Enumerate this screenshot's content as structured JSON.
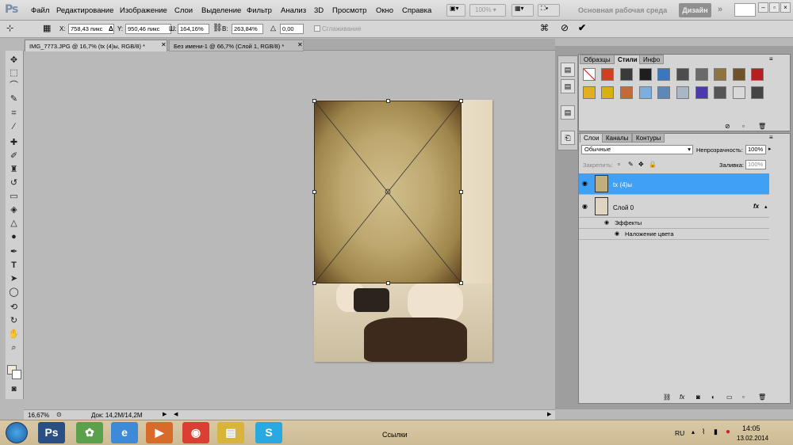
{
  "app": {
    "logo": "Ps"
  },
  "menu": [
    "Файл",
    "Редактирование",
    "Изображение",
    "Слои",
    "Выделение",
    "Фильтр",
    "Анализ",
    "3D",
    "Просмотр",
    "Окно",
    "Справка"
  ],
  "menubar_extras": {
    "zoom": "100%",
    "workspace": "Основная рабочая среда",
    "design": "Дизайн",
    "chevron": "»"
  },
  "options": {
    "x_label": "X:",
    "x_value": "758,43 пикс",
    "delta_label": "Δ",
    "y_label": "Y:",
    "y_value": "950,46 пикс",
    "w_label": "Ш:",
    "w_value": "164,16%",
    "h_label": "В:",
    "h_value": "263,84%",
    "angle_value": "0,00",
    "smoothing_label": "Сглаживание"
  },
  "tabs": [
    {
      "label": "IMG_7773.JPG @ 16,7% (tx (4)ы, RGB/8) *",
      "active": true
    },
    {
      "label": "Без имени-1 @ 66,7% (Слой 1, RGB/8) *",
      "active": false
    }
  ],
  "status": {
    "zoom": "16,67%",
    "doc": "Док: 14,2M/14,2M"
  },
  "swatch_panel": {
    "tabs": [
      "Образцы",
      "Стили",
      "Инфо"
    ],
    "active_tab": "Стили"
  },
  "layers_panel": {
    "tabs": [
      "Слои",
      "Каналы",
      "Контуры"
    ],
    "blend_mode": "Обычные",
    "opacity_label": "Непрозрачность:",
    "opacity_value": "100%",
    "lock_label": "Закрепить:",
    "fill_label": "Заливка:",
    "fill_value": "100%",
    "layers": [
      {
        "name": "tx (4)ы",
        "selected": true
      },
      {
        "name": "Слой 0",
        "selected": false,
        "fx": "fx"
      }
    ],
    "effects_label": "Эффекты",
    "effect_item": "Наложение цвета"
  },
  "taskbar": {
    "label": "Ссылки",
    "lang": "RU",
    "time": "14:05",
    "date": "13.02.2014"
  },
  "colors": {
    "selection_blue": "#3fa0f4",
    "menubar": "#d8d8d8",
    "canvas_bg": "#b9b9b9"
  }
}
